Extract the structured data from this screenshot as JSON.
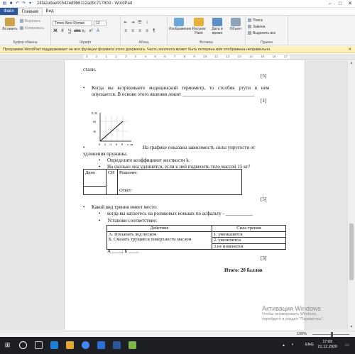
{
  "window": {
    "title": "24fa2a9ae9c542ed9b6112ad9c71780d - WordPad"
  },
  "tabs": [
    "Файл",
    "Главная",
    "Вид"
  ],
  "ribbon": {
    "clipboard": {
      "paste": "Вставить",
      "cut": "Вырезать",
      "copy": "Копировать",
      "label": "Буфер обмена"
    },
    "font": {
      "family": "Times New Roman",
      "size": "12",
      "label": "Шрифт"
    },
    "paragraph": {
      "label": "Абзац"
    },
    "insert": {
      "image": "Изображение",
      "paint": "Рисунок Paint",
      "datetime": "Дата и время",
      "object": "Объект",
      "label": "Вставка"
    },
    "editing": {
      "find": "Поиск",
      "replace": "Замена",
      "select_all": "Выделить все",
      "label": "Правка"
    }
  },
  "infobar": {
    "text": "Программа WordPad поддерживает не все функции формата этого документа. Часть контента может быть потеряна или отображена неправильно."
  },
  "ruler": {
    "ticks": [
      "3",
      "2",
      "1",
      "1",
      "2",
      "3",
      "4",
      "5",
      "6",
      "7",
      "8",
      "9",
      "10",
      "11",
      "12",
      "13",
      "14",
      "15",
      "16",
      "17"
    ]
  },
  "document": {
    "line_stali": "стали.",
    "mark5_a": "[5]",
    "thermometer": "Когда вы встряхиваете медицинский термометр, то столбик ртути в нем опускается. В основе этого явления лежит _____________________________",
    "mark1": "[1]",
    "graph": {
      "y_label": "F, Н",
      "y_ticks": [
        "60",
        "30"
      ],
      "x_ticks": [
        "0",
        "2",
        "4",
        "6",
        "8"
      ],
      "x_label": "x, см"
    },
    "graph_caption": "На графике показана зависимость силы упругости от удлинения пружины.",
    "q_k": "Определите коэффициент жесткости k.",
    "q_15kg": "На сколько она удлинится, если к ней подвесить тело массой 15 кг?",
    "table1": {
      "given": "Дано",
      "si": "СИ",
      "solution": "Решение:",
      "answer": "Ответ:"
    },
    "mark5_b": "[5]",
    "friction_q": "Какой вид трения имеет место:",
    "friction_a": "когда вы катаетесь на роликовых коньках по асфальту - ___________",
    "friction_b": "Установи соответствие:",
    "table2": {
      "col1": "Действие",
      "col2": "Сила трения",
      "rows": [
        [
          "А. Посыпать лед песком",
          "1. уменьшится"
        ],
        [
          "Б. Смазать трущиеся поверхности маслом",
          "2. увеличится"
        ],
        [
          "",
          "3.не изменится"
        ]
      ]
    },
    "ab_answer": "А ____; Б ____",
    "mark3": "[3]",
    "total": "Итого: 20 баллов"
  },
  "status": {
    "zoom": "100%"
  },
  "watermark": {
    "line1": "Активация Windows",
    "line2": "Чтобы активировать Windows,",
    "line3": "перейдите в раздел \"Параметры\"."
  },
  "taskbar": {
    "lang": "ENG",
    "time": "17:03",
    "date": "21.12.2020"
  },
  "colors": {
    "file_tab": "#2b579a",
    "infobar": "#fff1b8",
    "taskbar": "#1e1f24"
  }
}
